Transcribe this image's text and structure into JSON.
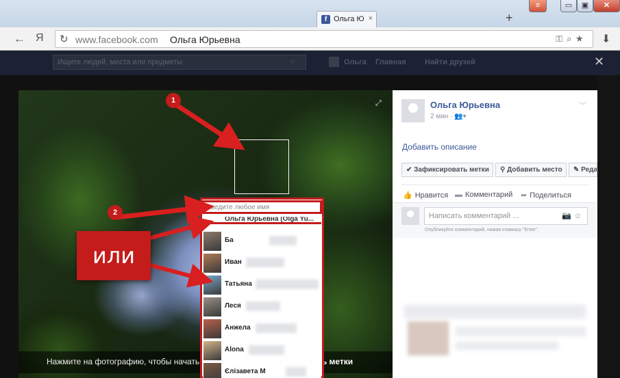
{
  "browser": {
    "tab_title": "Ольга Ю",
    "tab_favicon": "f",
    "tab_close": "×",
    "new_tab": "+",
    "window_buttons": {
      "minimize": "▭",
      "maximize": "▣",
      "close": "✕"
    },
    "back": "←",
    "logo": "Я",
    "reload": "↻",
    "url_domain": "www.facebook.com",
    "url_title": "Ольга Юрьевна",
    "download": "⬇"
  },
  "fb_topbar": {
    "search_placeholder": "Ищите людей, места или предметы",
    "profile_name": "Ольга",
    "home": "Главная",
    "find_friends": "Найти друзей",
    "viewer_close": "✕"
  },
  "photo": {
    "hint": "Нажмите на фотографию, чтобы начать отм",
    "hint_action": "вать метки"
  },
  "sidebar": {
    "name": "Ольга Юрьевна",
    "time": "2 мин · ",
    "add_description": "Добавить описание",
    "tools": [
      "✔ Зафиксировать метки",
      "⚲ Добавить место",
      "✎ Редак"
    ],
    "actions": {
      "like": "Нравится",
      "comment": "Комментарий",
      "share": "Поделиться"
    },
    "comment_placeholder": "Написать комментарий ...",
    "comment_hint": "Опубликуйте комментарий, нажав клавишу \"Enter\"."
  },
  "tagger": {
    "input_placeholder": "Введите любое имя",
    "first_entry": "Ольга Юрьевна (Olga Yu...",
    "friends": [
      {
        "name": "Ба",
        "color": "#8d7b6a"
      },
      {
        "name": "Иван",
        "color": "#b07a55"
      },
      {
        "name": "Татьяна",
        "color": "#7aa7c9"
      },
      {
        "name": "Леся",
        "color": "#9a8f86"
      },
      {
        "name": "Анжела",
        "color": "#b9614a"
      },
      {
        "name": "Alona",
        "color": "#d2b48c"
      },
      {
        "name": "Єлізавета М",
        "color": "#7b5a45"
      }
    ]
  },
  "annotations": {
    "badge1": "1",
    "badge2": "2",
    "ili": "или"
  },
  "colors": {
    "annotation_red": "#c41b1b",
    "facebook_blue": "#3b5998"
  }
}
